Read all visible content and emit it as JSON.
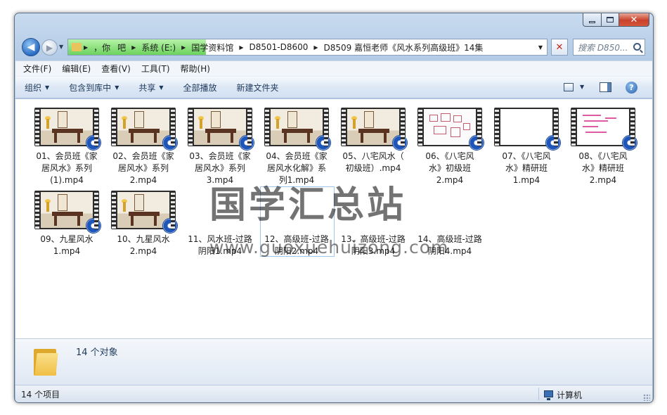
{
  "window": {
    "caption_buttons": {
      "minimize": "",
      "maximize": "",
      "close": "✕"
    }
  },
  "nav": {
    "back_glyph": "◀",
    "forward_glyph": "▶",
    "breadcrumbs": [
      "，你",
      "吧",
      "系统 (E:)",
      "国学资料馆",
      "D8501-D8600",
      "D8509 嘉恒老师《风水系列高级班》14集"
    ],
    "search_placeholder": "搜索 D850...",
    "clear_glyph": "✕"
  },
  "menu": [
    "文件(F)",
    "编辑(E)",
    "查看(V)",
    "工具(T)",
    "帮助(H)"
  ],
  "toolbar": {
    "organize": "组织",
    "include_library": "包含到库中",
    "share": "共享",
    "play_all": "全部播放",
    "new_folder": "新建文件夹",
    "help_glyph": "?"
  },
  "files": [
    {
      "line1": "01、会员班《家",
      "line2": "居风水》系列",
      "line3": "(1).mp4",
      "thumb": "scene"
    },
    {
      "line1": "02、会员班《家",
      "line2": "居风水》系列",
      "line3": "2.mp4",
      "thumb": "scene"
    },
    {
      "line1": "03、会员班《家",
      "line2": "居风水》系列",
      "line3": "3.mp4",
      "thumb": "scene"
    },
    {
      "line1": "04、会员班《家",
      "line2": "居风水化解》系",
      "line3": "列1.mp4",
      "thumb": "scene"
    },
    {
      "line1": "05、八宅风水（",
      "line2": "初级班）.mp4",
      "line3": "",
      "thumb": "scene"
    },
    {
      "line1": "06、《八宅风",
      "line2": "水》初级班",
      "line3": "2.mp4",
      "thumb": "diagram"
    },
    {
      "line1": "07、《八宅风",
      "line2": "水》精研班",
      "line3": "1.mp4",
      "thumb": "white"
    },
    {
      "line1": "08、《八宅风",
      "line2": "水》精研班",
      "line3": "2.mp4",
      "thumb": "notes"
    },
    {
      "line1": "09、九星风水",
      "line2": "1.mp4",
      "line3": "",
      "thumb": "scene"
    },
    {
      "line1": "10、九星风水",
      "line2": "2.mp4",
      "line3": "",
      "thumb": "scene"
    },
    {
      "line1": "11、风水班-过路",
      "line2": "阴阳1.mp4",
      "line3": "",
      "thumb": "none"
    },
    {
      "line1": "12、高级班-过路",
      "line2": "阴阳2.mp4",
      "line3": "",
      "thumb": "none"
    },
    {
      "line1": "13、高级班-过路",
      "line2": "阴阳3.mp4",
      "line3": "",
      "thumb": "none"
    },
    {
      "line1": "14、高级班-过路",
      "line2": "阴阳4.mp4",
      "line3": "",
      "thumb": "none"
    }
  ],
  "watermark": {
    "text": "国学汇总站",
    "url": "www.guoxuehuizong.com"
  },
  "details": {
    "count": "14 个对象"
  },
  "status": {
    "items": "14 个项目",
    "location": "计算机"
  }
}
